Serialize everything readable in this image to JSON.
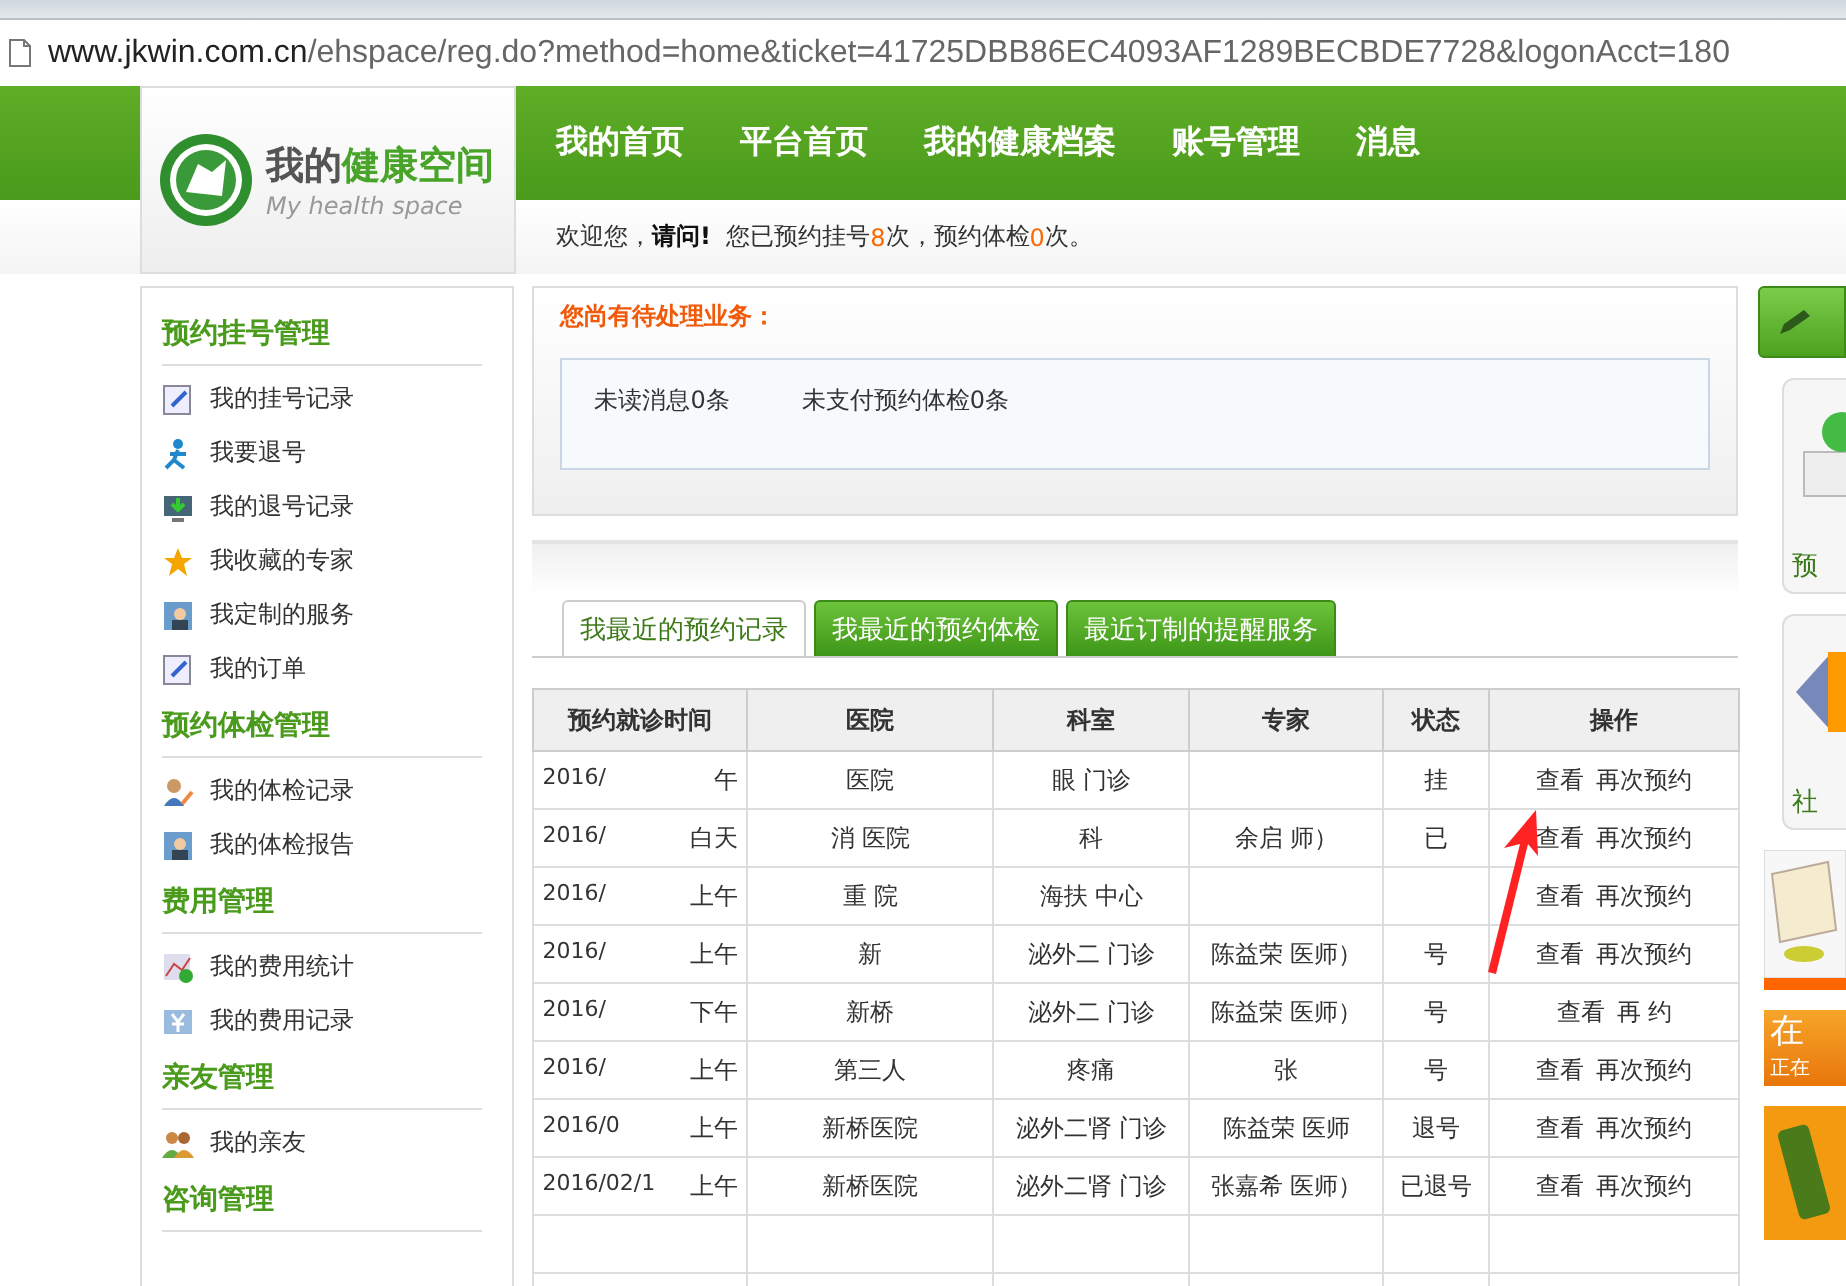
{
  "address_bar": {
    "host": "www.jkwin.com.cn",
    "path": "/ehspace/reg.do?method=home&ticket=41725DBB86EC4093AF1289BECBDE7728&logonAcct=180"
  },
  "logo": {
    "title_part1": "我的",
    "title_part2": "健康空间",
    "subtitle": "My health space"
  },
  "nav": [
    {
      "label": "我的首页"
    },
    {
      "label": "平台首页"
    },
    {
      "label": "我的健康档案"
    },
    {
      "label": "账号管理"
    },
    {
      "label": "消息"
    }
  ],
  "welcome": {
    "prefix": "欢迎您，",
    "name": "请问!",
    "text1": "您已预约挂号",
    "count1": "8",
    "text2": "次，预约体检",
    "count2": "0",
    "text3": "次。"
  },
  "sidebar": [
    {
      "title": "预约挂号管理",
      "items": [
        "我的挂号记录",
        "我要退号",
        "我的退号记录",
        "我收藏的专家",
        "我定制的服务",
        "我的订单"
      ]
    },
    {
      "title": "预约体检管理",
      "items": [
        "我的体检记录",
        "我的体检报告"
      ]
    },
    {
      "title": "费用管理",
      "items": [
        "我的费用统计",
        "我的费用记录"
      ]
    },
    {
      "title": "亲友管理",
      "items": [
        "我的亲友"
      ]
    },
    {
      "title": "咨询管理"
    }
  ],
  "pending": {
    "title": "您尚有待处理业务：",
    "items": [
      "未读消息0条",
      "未支付预约体检0条"
    ]
  },
  "tabs": [
    {
      "label": "我最近的预约记录",
      "selected": true
    },
    {
      "label": "我最近的预约体检",
      "selected": false
    },
    {
      "label": "最近订制的提醒服务",
      "selected": false
    }
  ],
  "table": {
    "columns": [
      "预约就诊时间",
      "医院",
      "科室",
      "专家",
      "状态",
      "操作"
    ],
    "rows": [
      {
        "date": "2016/",
        "period": "午",
        "hospital": "医院",
        "department": "眼 门诊",
        "expert": "",
        "status": "挂",
        "actions": [
          "查看",
          "再次预约"
        ]
      },
      {
        "date": "2016/",
        "period": "白天",
        "hospital": "消 医院",
        "department": "科",
        "expert": "余启 师）",
        "status": "已",
        "actions": [
          "查看",
          "再次预约"
        ]
      },
      {
        "date": "2016/",
        "period": "上午",
        "hospital": "重 院",
        "department": "海扶 中心",
        "expert": "",
        "status": "",
        "actions": [
          "查看",
          "再次预约"
        ]
      },
      {
        "date": "2016/",
        "period": "上午",
        "hospital": "新",
        "department": "泌外二 门诊",
        "expert": "陈益荣 医师）",
        "status": "号",
        "actions": [
          "查看",
          "再次预约"
        ]
      },
      {
        "date": "2016/",
        "period": "下午",
        "hospital": "新桥",
        "department": "泌外二 门诊",
        "expert": "陈益荣 医师）",
        "status": "号",
        "actions": [
          "查看",
          "再 约"
        ]
      },
      {
        "date": "2016/",
        "period": "上午",
        "hospital": "第三人",
        "department": "疼痛",
        "expert": "张",
        "status": "号",
        "actions": [
          "查看",
          "再次预约"
        ]
      },
      {
        "date": "2016/0",
        "period": "上午",
        "hospital": "新桥医院",
        "department": "泌外二肾 门诊",
        "expert": "陈益荣 医师",
        "status": "退号",
        "actions": [
          "查看",
          "再次预约"
        ]
      },
      {
        "date": "2016/02/1",
        "period": "上午",
        "hospital": "新桥医院",
        "department": "泌外二肾 门诊",
        "expert": "张嘉希 医师）",
        "status": "已退号",
        "actions": [
          "查看",
          "再次预约"
        ]
      }
    ]
  },
  "right_panel": {
    "cards": [
      {
        "label": "预"
      },
      {
        "label": "社"
      }
    ],
    "banner_title": "在",
    "banner_subtitle": "正在"
  }
}
